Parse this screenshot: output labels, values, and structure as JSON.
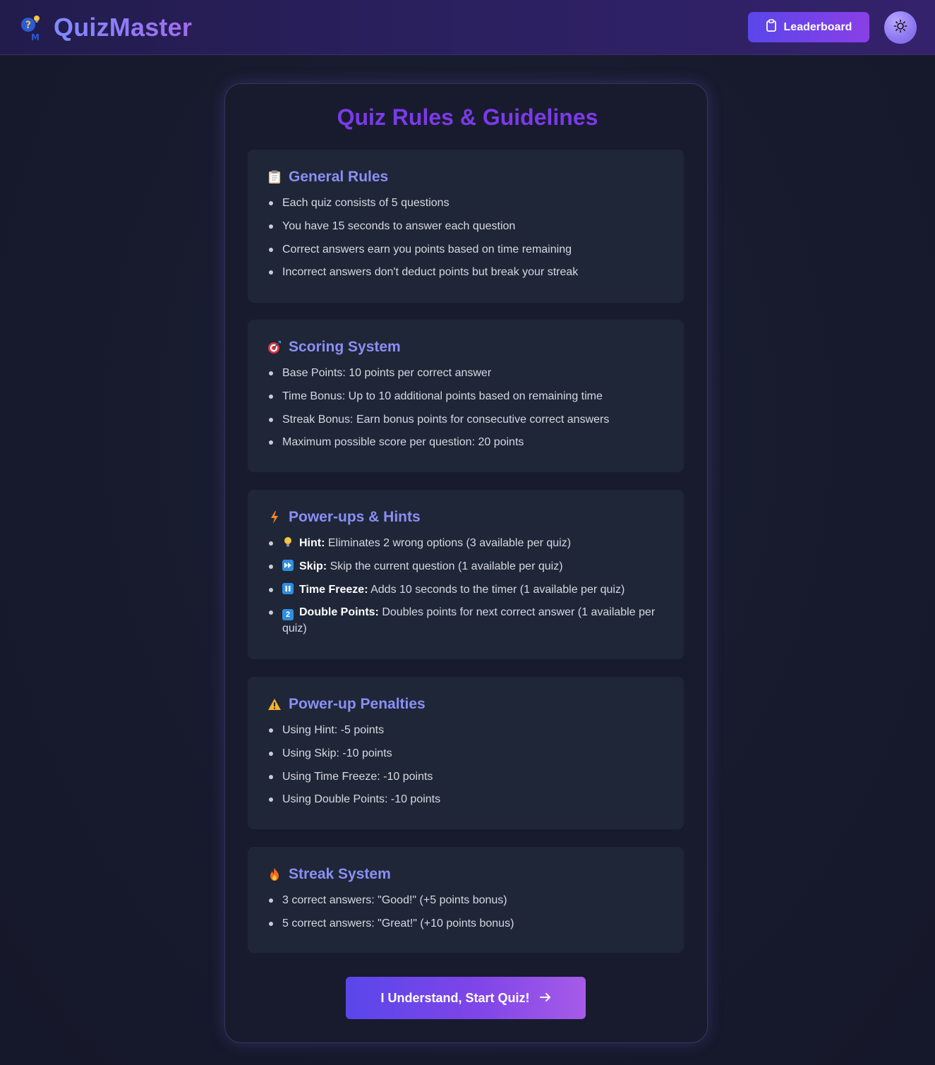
{
  "header": {
    "brand": "QuizMaster",
    "leaderboard_label": "Leaderboard"
  },
  "page": {
    "title": "Quiz Rules & Guidelines",
    "start_button": "I Understand, Start Quiz!"
  },
  "sections": [
    {
      "title": "General Rules",
      "icon": "clipboard-icon",
      "items": [
        "Each quiz consists of 5 questions",
        "You have 15 seconds to answer each question",
        "Correct answers earn you points based on time remaining",
        "Incorrect answers don't deduct points but break your streak"
      ]
    },
    {
      "title": "Scoring System",
      "icon": "target-icon",
      "items": [
        "Base Points: 10 points per correct answer",
        "Time Bonus: Up to 10 additional points based on remaining time",
        "Streak Bonus: Earn bonus points for consecutive correct answers",
        "Maximum possible score per question: 20 points"
      ]
    },
    {
      "title": "Power-ups & Hints",
      "icon": "lightning-icon",
      "items": [
        {
          "icon": "lightbulb-icon",
          "label": "Hint:",
          "text": " Eliminates 2 wrong options (3 available per quiz)"
        },
        {
          "icon": "fast-forward-icon",
          "label": "Skip:",
          "text": " Skip the current question (1 available per quiz)"
        },
        {
          "icon": "pause-icon",
          "label": "Time Freeze:",
          "text": " Adds 10 seconds to the timer (1 available per quiz)"
        },
        {
          "icon": "keycap-two-icon",
          "label": "Double Points:",
          "text": " Doubles points for next correct answer (1 available per quiz)"
        }
      ]
    },
    {
      "title": "Power-up Penalties",
      "icon": "warning-icon",
      "items": [
        "Using Hint: -5 points",
        "Using Skip: -10 points",
        "Using Time Freeze: -10 points",
        "Using Double Points: -10 points"
      ]
    },
    {
      "title": "Streak System",
      "icon": "fire-icon",
      "items": [
        "3 correct answers: \"Good!\" (+5 points bonus)",
        "5 correct answers: \"Great!\" (+10 points bonus)"
      ]
    }
  ],
  "colors": {
    "accent": "#5a46ea",
    "title": "#7a3be8",
    "section_title": "#8a8ff6",
    "section_bg": "#1f2637"
  }
}
